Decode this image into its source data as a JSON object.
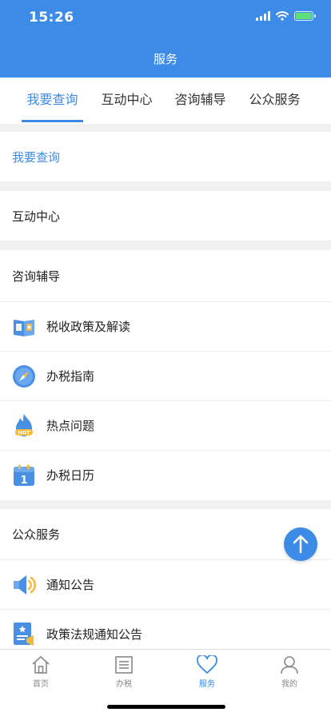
{
  "status_bar": {
    "time": "15:26"
  },
  "header": {
    "title": "服务"
  },
  "tabs": [
    {
      "label": "我要查询",
      "active": true
    },
    {
      "label": "互动中心",
      "active": false
    },
    {
      "label": "咨询辅导",
      "active": false
    },
    {
      "label": "公众服务",
      "active": false
    }
  ],
  "sections": {
    "query": {
      "title": "我要查询"
    },
    "interaction": {
      "title": "互动中心"
    },
    "consult": {
      "title": "咨询辅导",
      "items": [
        {
          "label": "税收政策及解读",
          "icon": "policy-book-icon"
        },
        {
          "label": "办税指南",
          "icon": "compass-icon"
        },
        {
          "label": "热点问题",
          "icon": "hot-flame-icon"
        },
        {
          "label": "办税日历",
          "icon": "calendar-icon"
        }
      ]
    },
    "public": {
      "title": "公众服务",
      "items": [
        {
          "label": "通知公告",
          "icon": "speaker-icon"
        },
        {
          "label": "政策法规通知公告",
          "icon": "policy-announcement-icon"
        }
      ]
    }
  },
  "icon_text": {
    "hot_badge": "HOT",
    "calendar_day": "1"
  },
  "tab_bar": [
    {
      "label": "首页",
      "icon": "home-icon",
      "active": false
    },
    {
      "label": "办税",
      "icon": "list-icon",
      "active": false
    },
    {
      "label": "服务",
      "icon": "heart-icon",
      "active": true
    },
    {
      "label": "我的",
      "icon": "user-icon",
      "active": false
    }
  ],
  "colors": {
    "primary": "#3c8be6",
    "background": "#f1f1f1",
    "inactive": "#888888"
  }
}
